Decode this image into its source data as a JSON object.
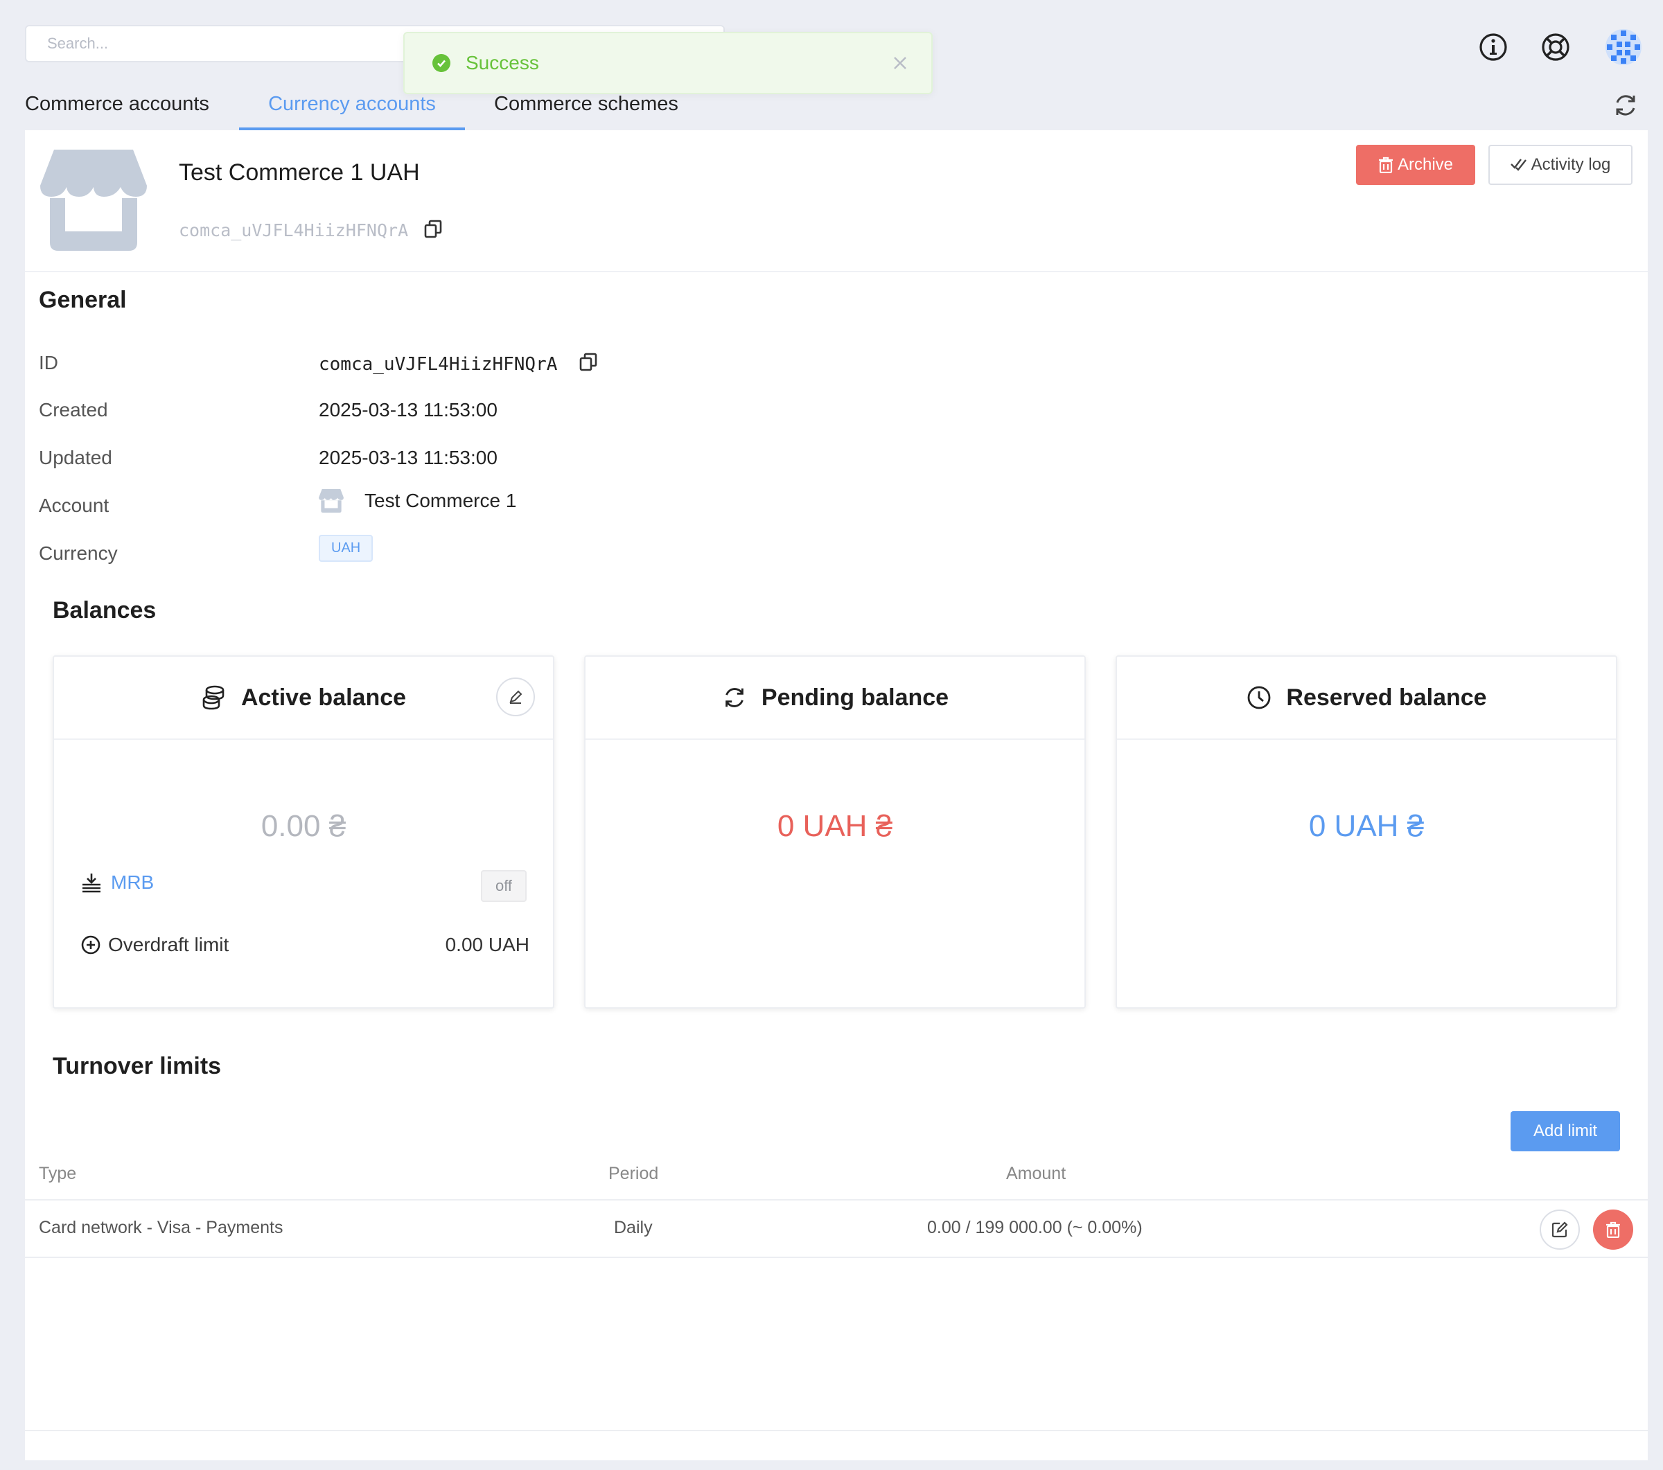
{
  "search": {
    "placeholder": "Search..."
  },
  "toast": {
    "message": "Success"
  },
  "tabs": [
    {
      "label": "Commerce accounts",
      "active": false
    },
    {
      "label": "Currency accounts",
      "active": true
    },
    {
      "label": "Commerce schemes",
      "active": false
    }
  ],
  "header": {
    "title": "Test Commerce 1 UAH",
    "id": "comca_uVJFL4HiizHFNQrA",
    "archive_label": "Archive",
    "activity_log_label": "Activity log"
  },
  "general": {
    "heading": "General",
    "rows": {
      "id": {
        "label": "ID",
        "value": "comca_uVJFL4HiizHFNQrA"
      },
      "created": {
        "label": "Created",
        "value": "2025-03-13 11:53:00"
      },
      "updated": {
        "label": "Updated",
        "value": "2025-03-13 11:53:00"
      },
      "account": {
        "label": "Account",
        "value": "Test Commerce 1"
      },
      "currency": {
        "label": "Currency",
        "value": "UAH"
      }
    }
  },
  "balances": {
    "heading": "Balances",
    "active": {
      "title": "Active balance",
      "amount": "0.00 ₴",
      "mrb_label": "MRB",
      "mrb_state": "off",
      "overdraft_label": "Overdraft limit",
      "overdraft_value": "0.00 UAH"
    },
    "pending": {
      "title": "Pending balance",
      "amount": "0 UAH ₴"
    },
    "reserved": {
      "title": "Reserved balance",
      "amount": "0 UAH ₴"
    }
  },
  "turnover": {
    "heading": "Turnover limits",
    "add_label": "Add limit",
    "columns": {
      "type": "Type",
      "period": "Period",
      "amount": "Amount"
    },
    "rows": [
      {
        "type": "Card network - Visa - Payments",
        "period": "Daily",
        "amount": "0.00 / 199 000.00 (~ 0.00%)"
      }
    ]
  },
  "colors": {
    "accent": "#5b9bf0",
    "danger": "#ee6e66",
    "success": "#67c23a",
    "pending_amount": "#e8615a",
    "reserved_amount": "#5b9bf0",
    "active_amount": "#b4b7be"
  }
}
